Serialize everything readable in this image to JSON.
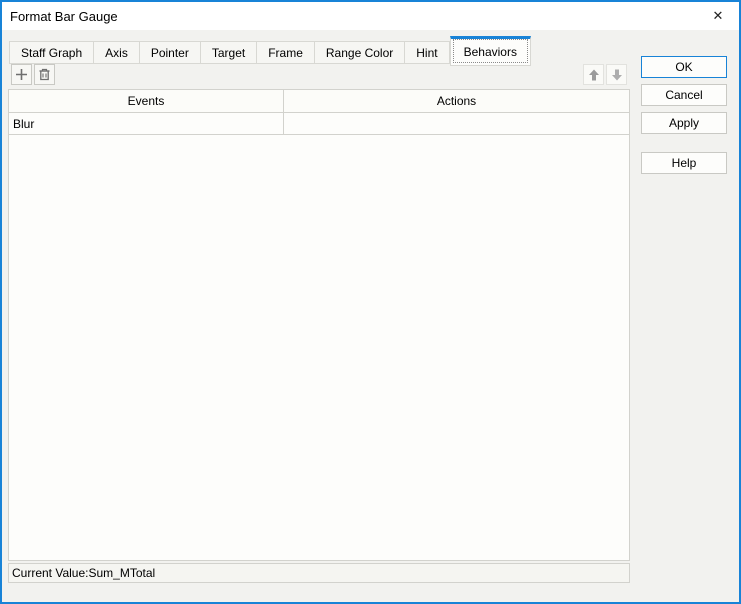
{
  "window": {
    "title": "Format Bar Gauge",
    "close_icon": "✕"
  },
  "tabs": [
    {
      "label": "Staff Graph",
      "active": false
    },
    {
      "label": "Axis",
      "active": false
    },
    {
      "label": "Pointer",
      "active": false
    },
    {
      "label": "Target",
      "active": false
    },
    {
      "label": "Frame",
      "active": false
    },
    {
      "label": "Range Color",
      "active": false
    },
    {
      "label": "Hint",
      "active": false
    },
    {
      "label": "Behaviors",
      "active": true
    }
  ],
  "toolbar": {
    "icons": [
      "plus-icon",
      "trash-icon",
      "up-arrow-icon",
      "down-arrow-icon"
    ],
    "up_down_disabled": true
  },
  "table": {
    "columns": [
      "Events",
      "Actions"
    ],
    "rows": [
      {
        "events": "Blur",
        "actions": ""
      }
    ]
  },
  "buttons": {
    "ok": "OK",
    "cancel": "Cancel",
    "apply": "Apply",
    "help": "Help"
  },
  "status": {
    "text": "Current Value:Sum_MTotal"
  },
  "colors": {
    "accent": "#1883d7",
    "dialog_bg": "#f2f2ef",
    "panel_bg": "#fdfdfb",
    "border": "#d2d2cd",
    "icon_gray": "#6e6e6e",
    "disabled_arrow": "#a3a3a3"
  }
}
